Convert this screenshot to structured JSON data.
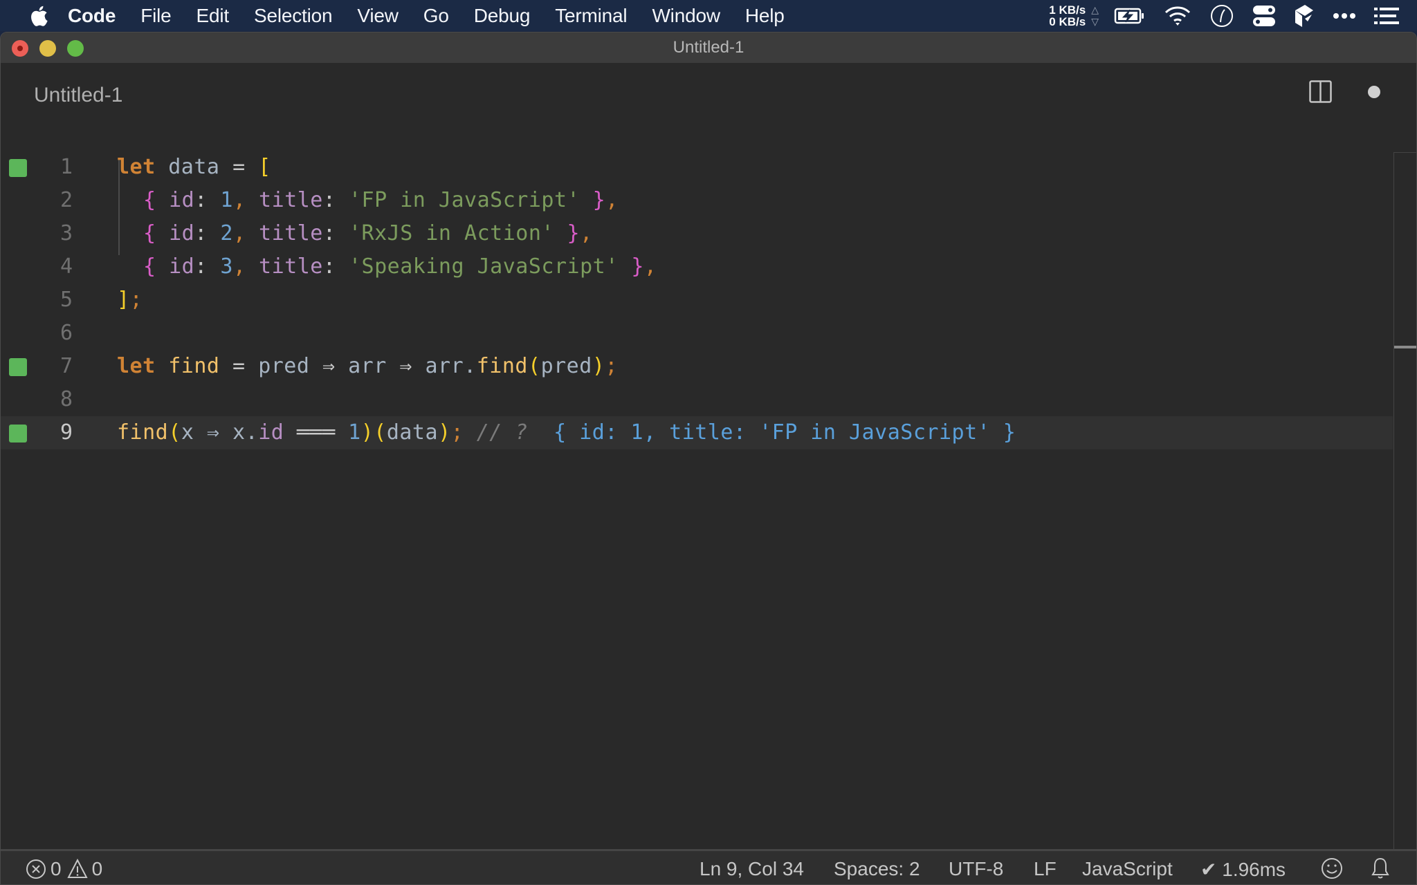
{
  "menubar": {
    "apple_icon": "apple-logo-icon",
    "items": [
      "Code",
      "File",
      "Edit",
      "Selection",
      "View",
      "Go",
      "Debug",
      "Terminal",
      "Window",
      "Help"
    ],
    "net_up": "1 KB/s",
    "net_down": "0 KB/s",
    "up_arrow": "△",
    "down_arrow": "▽",
    "tray_icons": [
      "battery-charging-icon",
      "wifi-icon",
      "clock-icon",
      "toggle-switches-icon",
      "cube-icon",
      "more-icon",
      "list-icon"
    ]
  },
  "window": {
    "title": "Untitled-1"
  },
  "tab": {
    "title": "Untitled-1",
    "split_icon": "split-editor-icon",
    "dirty_indicator": "unsaved-dot-icon"
  },
  "editor": {
    "active_line": 9,
    "lines": [
      {
        "number": "1",
        "marker": true
      },
      {
        "number": "2",
        "marker": false
      },
      {
        "number": "3",
        "marker": false
      },
      {
        "number": "4",
        "marker": false
      },
      {
        "number": "5",
        "marker": false
      },
      {
        "number": "6",
        "marker": false
      },
      {
        "number": "7",
        "marker": true
      },
      {
        "number": "8",
        "marker": false
      },
      {
        "number": "9",
        "marker": true
      }
    ],
    "tokens": {
      "l1": [
        "let",
        " data ",
        "=",
        " ",
        "["
      ],
      "l2": [
        "{",
        " id",
        ":",
        " 1",
        ",",
        " title",
        ":",
        " 'FP in JavaScript'",
        " ",
        "}",
        ","
      ],
      "l3": [
        "{",
        " id",
        ":",
        " 2",
        ",",
        " title",
        ":",
        " 'RxJS in Action'",
        " ",
        "}",
        ","
      ],
      "l4": [
        "{",
        " id",
        ":",
        " 3",
        ",",
        " title",
        ":",
        " 'Speaking JavaScript'",
        " ",
        "}",
        ","
      ],
      "l5": [
        "]",
        ";"
      ],
      "l7": [
        "let",
        " ",
        "find",
        " = ",
        "pred",
        " ⇒ ",
        "arr",
        " ⇒ ",
        "arr.",
        "find",
        "(",
        "pred",
        ")",
        ";"
      ],
      "l9": [
        "find",
        "(",
        "x ⇒ x.",
        "id",
        " ═══ ",
        "1",
        ")",
        "(",
        "data",
        ")",
        ";",
        " // ? ",
        " { id: 1, title: 'FP in JavaScript' }"
      ]
    }
  },
  "statusbar": {
    "errors": "0",
    "warnings": "0",
    "position": "Ln 9, Col 34",
    "indent": "Spaces: 2",
    "encoding": "UTF-8",
    "eol": "LF",
    "language": "JavaScript",
    "timing": "✔ 1.96ms",
    "feedback_icon": "smiley-icon",
    "notifications_icon": "bell-icon"
  }
}
